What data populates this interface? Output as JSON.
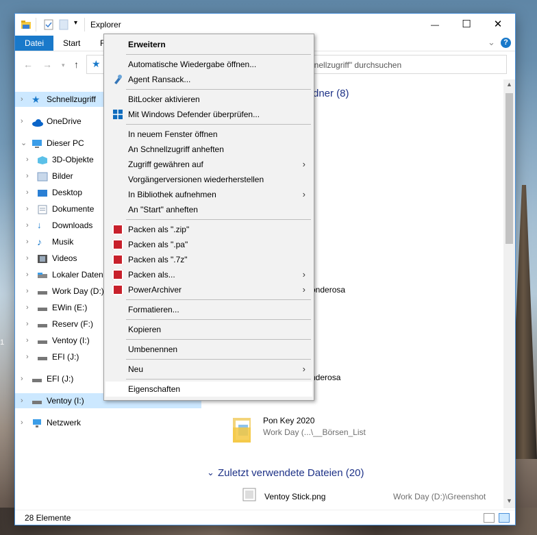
{
  "window": {
    "title": "Explorer",
    "minimize": "—",
    "maximize": "☐",
    "close": "✕"
  },
  "ribbon": {
    "tabs": [
      "Datei",
      "Start",
      "F"
    ],
    "collapse": "⌄",
    "help": "?"
  },
  "address": {
    "search_text": "hnellzugriff\" durchsuchen"
  },
  "nav": {
    "items": [
      {
        "label": "Schnellzugriff"
      },
      {
        "label": "OneDrive"
      },
      {
        "label": "Dieser PC"
      },
      {
        "label": "3D-Objekte"
      },
      {
        "label": "Bilder"
      },
      {
        "label": "Desktop"
      },
      {
        "label": "Dokumente"
      },
      {
        "label": "Downloads"
      },
      {
        "label": "Musik"
      },
      {
        "label": "Videos"
      },
      {
        "label": "Lokaler Datentr"
      },
      {
        "label": "Work Day (D:)"
      },
      {
        "label": "EWin (E:)"
      },
      {
        "label": "Reserv (F:)"
      },
      {
        "label": "Ventoy (I:)"
      },
      {
        "label": "EFI (J:)"
      },
      {
        "label": "EFI (J:)"
      },
      {
        "label": "Ventoy (I:)"
      },
      {
        "label": "Netzwerk"
      }
    ]
  },
  "content": {
    "group1_label": "rdner (8)",
    "frag1": "onderosa",
    "frag2": "nderosa",
    "pon_key_title": "Pon Key 2020",
    "pon_key_sub": "Work Day (...\\__Börsen_List",
    "recent_group": "Zuletzt verwendete Dateien (20)",
    "recent_file": "Ventoy Stick.png",
    "recent_path": "Work Day (D:)\\Greenshot"
  },
  "status": {
    "count": "28 Elemente"
  },
  "context_menu": {
    "items": [
      {
        "label": "Erweitern",
        "bold": true
      },
      {
        "label": "Automatische Wiedergabe öffnen..."
      },
      {
        "label": "Agent Ransack..."
      },
      {
        "label": "BitLocker aktivieren"
      },
      {
        "label": "Mit Windows Defender überprüfen..."
      },
      {
        "label": "In neuem Fenster öffnen"
      },
      {
        "label": "An Schnellzugriff anheften"
      },
      {
        "label": "Zugriff gewähren auf"
      },
      {
        "label": "Vorgängerversionen wiederherstellen"
      },
      {
        "label": "In Bibliothek aufnehmen"
      },
      {
        "label": "An \"Start\" anheften"
      },
      {
        "label": "Packen als \".zip\""
      },
      {
        "label": "Packen als \".pa\""
      },
      {
        "label": "Packen als \".7z\""
      },
      {
        "label": "Packen als..."
      },
      {
        "label": "PowerArchiver"
      },
      {
        "label": "Formatieren..."
      },
      {
        "label": "Kopieren"
      },
      {
        "label": "Umbenennen"
      },
      {
        "label": "Neu"
      },
      {
        "label": "Eigenschaften"
      }
    ]
  },
  "desktop": {
    "left_fragment": "1"
  }
}
